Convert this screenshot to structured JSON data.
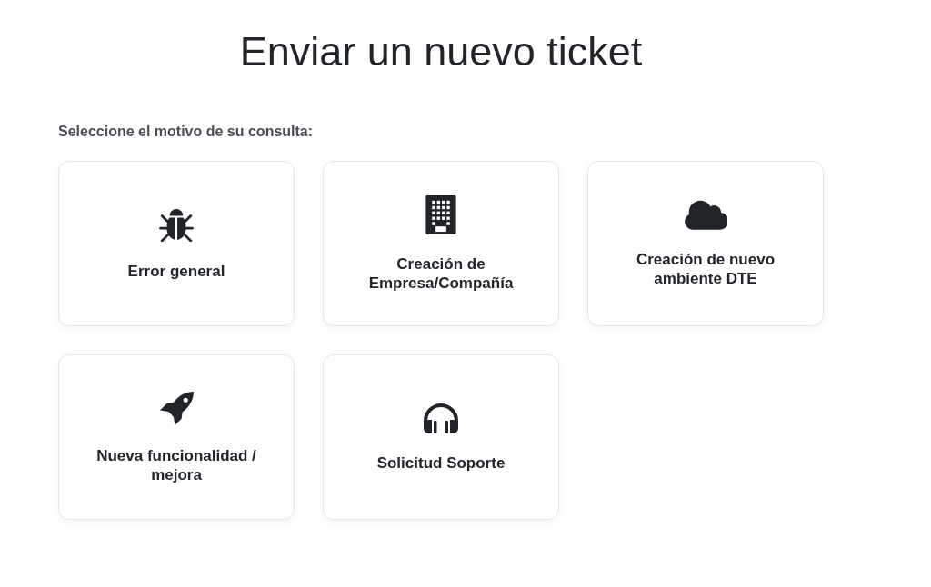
{
  "title": "Enviar un nuevo ticket",
  "prompt": "Seleccione el motivo de su consulta:",
  "options": [
    {
      "kind": "bug",
      "label": "Error general"
    },
    {
      "kind": "building",
      "label": "Creación de Empresa/Compañía"
    },
    {
      "kind": "cloud",
      "label": "Creación de nuevo ambiente DTE"
    },
    {
      "kind": "rocket",
      "label": "Nueva funcionalidad / mejora"
    },
    {
      "kind": "headphones",
      "label": "Solicitud Soporte"
    }
  ]
}
